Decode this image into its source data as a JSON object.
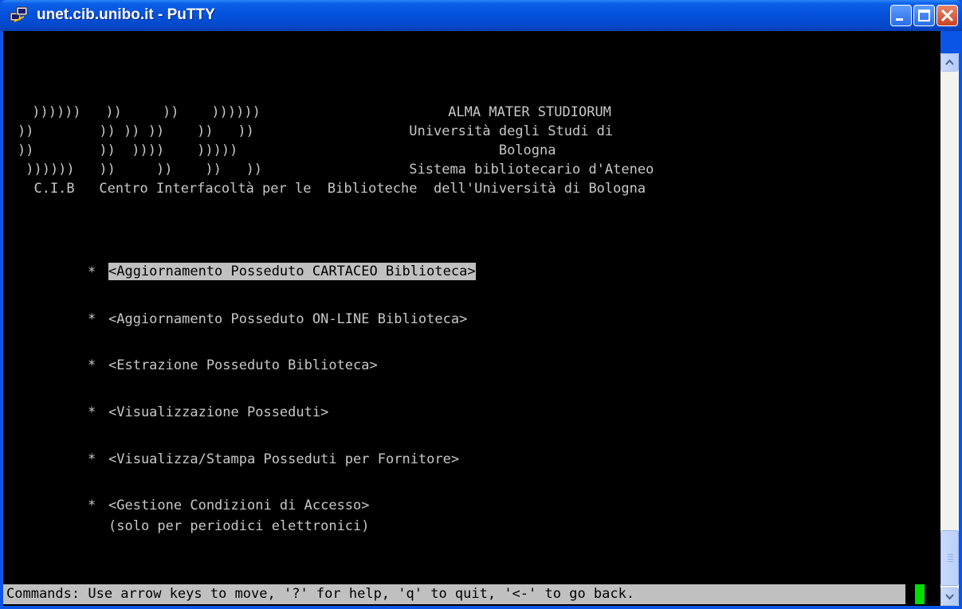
{
  "window": {
    "title": "unet.cib.unibo.it - PuTTY",
    "icon": "putty-terminal-icon",
    "controls": [
      "minimize-icon",
      "maximize-icon",
      "close-icon"
    ]
  },
  "colors": {
    "titlebar": "#0550DA",
    "terminal_bg": "#000000",
    "terminal_fg": "#C8C8C8",
    "highlight_bg": "#C0C0C0",
    "cursor": "#00E000"
  },
  "banner": {
    "lines": [
      " ))))))   ))     ))    ))))))                       ALMA MATER STUDIORUM",
      "))        )) )) ))    ))   ))                   Università degli Studi di",
      "))        ))  ))))    )))))                                Bologna",
      " ))))))   ))     ))    ))   ))                  Sistema bibliotecario d'Ateneo",
      "  C.I.B   Centro Interfacoltà per le  Biblioteche  dell'Università di Bologna"
    ]
  },
  "menu": {
    "items": [
      {
        "bullet": "*",
        "label": "<Aggiornamento Posseduto CARTACEO Biblioteca>",
        "selected": true
      },
      {
        "bullet": "*",
        "label": "<Aggiornamento Posseduto ON-LINE Biblioteca>",
        "selected": false
      },
      {
        "bullet": "*",
        "label": "<Estrazione Posseduto Biblioteca>",
        "selected": false
      },
      {
        "bullet": "*",
        "label": "<Visualizzazione Posseduti>",
        "selected": false
      },
      {
        "bullet": "*",
        "label": "<Visualizza/Stampa Posseduti per Fornitore>",
        "selected": false
      },
      {
        "bullet": "*",
        "label": "<Gestione Condizioni di Accesso>",
        "selected": false,
        "note": "(solo per periodici elettronici)"
      }
    ]
  },
  "status": {
    "text": "Commands: Use arrow keys to move, '?' for help, 'q' to quit, '<-' to go back."
  }
}
